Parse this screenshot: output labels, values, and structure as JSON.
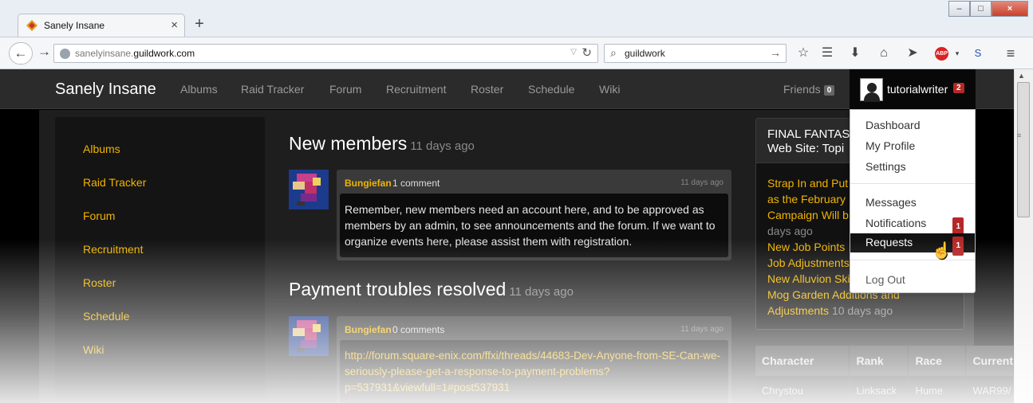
{
  "browser": {
    "tab_title": "Sanely Insane",
    "new_tab": "+",
    "tab_close": "×",
    "url_domain_prefix": "sanelyinsane.",
    "url_domain_main": "guildwork.com",
    "search_value": "guildwork",
    "window_controls": {
      "minimize": "–",
      "maximize": "□",
      "close": "×"
    }
  },
  "site": {
    "brand": "Sanely Insane",
    "topnav": [
      "Albums",
      "Raid Tracker",
      "Forum",
      "Recruitment",
      "Roster",
      "Schedule",
      "Wiki"
    ],
    "friends_label": "Friends",
    "friends_count": "0",
    "user_name": "tutorialwriter",
    "user_badge": "2"
  },
  "sidebar": {
    "items": [
      "Albums",
      "Raid Tracker",
      "Forum",
      "Recruitment",
      "Roster",
      "Schedule",
      "Wiki"
    ]
  },
  "posts": [
    {
      "title": "New members",
      "time": "11 days ago",
      "author": "Bungiefan",
      "comments": "1 comment",
      "comment_time": "11 days ago",
      "body": "Remember, new members need an account here, and to be approved as members by an admin, to see announcements and the forum. If we want to organize events here, please assist them with registration."
    },
    {
      "title": "Payment troubles resolved",
      "time": "11 days ago",
      "author": "Bungiefan",
      "comments": "0 comments",
      "comment_time": "11 days ago",
      "body": "http://forum.square-enix.com/ffxi/threads/44683-Dev-Anyone-from-SE-Can-we-seriously-please-get-a-response-to-payment-problems?p=537931&viewfull=1#post537931"
    }
  ],
  "right_panel": {
    "title_line1": "FINAL FANTAS",
    "title_line2": "Web Site: Topi",
    "lines": [
      {
        "text": "Strap In and Put",
        "time": ""
      },
      {
        "text": "as the February",
        "time": ""
      },
      {
        "text": "Campaign Will b",
        "time": ""
      },
      {
        "text": "",
        "time": "days ago"
      },
      {
        "text": "New Job Points",
        "time": ""
      },
      {
        "text": "Job Adjustments",
        "time": ""
      },
      {
        "text": "New Alluvion Ski",
        "time": ""
      },
      {
        "text": "Mog Garden Additions and",
        "time": ""
      },
      {
        "text": "Adjustments",
        "time": "10 days ago"
      }
    ]
  },
  "char_table": {
    "headers": [
      "Character",
      "Rank",
      "Race",
      "Current"
    ],
    "rows": [
      [
        "Chrystou",
        "Linksack",
        "Hume",
        "WAR99/"
      ]
    ]
  },
  "user_menu": {
    "items": [
      "Dashboard",
      "My Profile",
      "Settings",
      "Messages",
      "Notifications",
      "Requests",
      "Log Out"
    ],
    "notifications_badge": "1",
    "requests_badge": "1",
    "active": "Requests"
  },
  "colors": {
    "accent_link": "#f0b400",
    "badge_red": "#b52828",
    "nav_bg": "#2b2b2b"
  },
  "icons": [
    "firefox-favicon",
    "back-arrow-icon",
    "forward-arrow-icon",
    "globe-icon",
    "reload-icon",
    "search-icon",
    "star-icon",
    "reading-list-icon",
    "download-icon",
    "home-icon",
    "send-icon",
    "adblock-icon",
    "menu-icon",
    "cursor-hand-icon"
  ]
}
